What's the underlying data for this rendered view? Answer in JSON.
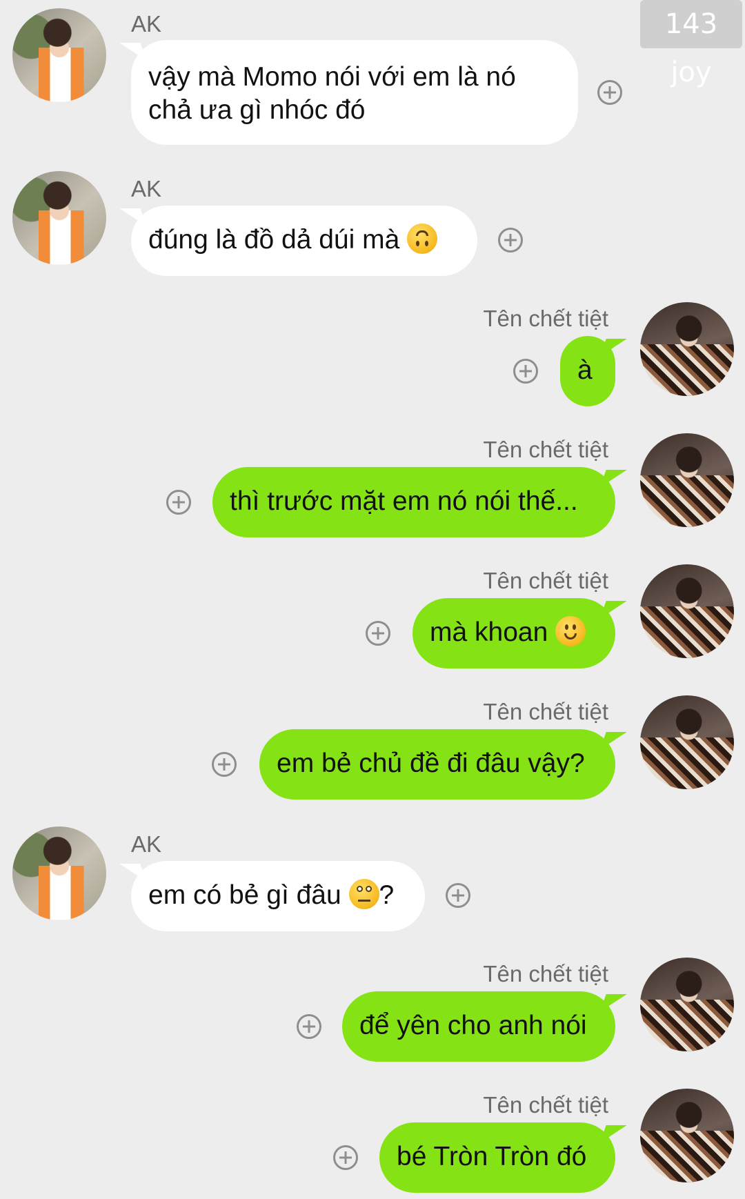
{
  "watermark": "143 joy",
  "messages": [
    {
      "sender": "AK",
      "text": "vậy mà Momo nói với em là nó",
      "text2": "chả ưa gì nhóc đó",
      "avatar": "ak-avatar"
    },
    {
      "sender": "AK",
      "text": "đúng là đồ dả dúi mà",
      "emoji": "upside-down-face-emoji",
      "avatar": "ak-avatar"
    },
    {
      "sender": "Tên chết tiệt",
      "text": "à",
      "avatar": "ten-avatar"
    },
    {
      "sender": "Tên chết tiệt",
      "text": "thì trước mặt em nó nói thế...",
      "avatar": "ten-avatar"
    },
    {
      "sender": "Tên chết tiệt",
      "text": "mà khoan",
      "emoji": "slightly-smiling-face-emoji",
      "avatar": "ten-avatar"
    },
    {
      "sender": "Tên chết tiệt",
      "text": "em bẻ chủ đề đi đâu vậy?",
      "avatar": "ten-avatar"
    },
    {
      "sender": "AK",
      "text": "em có bẻ gì đâu",
      "emoji": "face-with-rolling-eyes-emoji",
      "text_after": "?",
      "avatar": "ak-avatar"
    },
    {
      "sender": "Tên chết tiệt",
      "text": "để yên cho anh nói",
      "avatar": "ten-avatar"
    },
    {
      "sender": "Tên chết tiệt",
      "text": "bé Tròn Tròn đó",
      "avatar": "ten-avatar"
    }
  ],
  "icons": {
    "react": "plus-circle-icon"
  },
  "colors": {
    "background": "#ededed",
    "outgoing_bubble": "#85e315",
    "incoming_bubble": "#ffffff",
    "sender_text": "#6a6a6a"
  }
}
